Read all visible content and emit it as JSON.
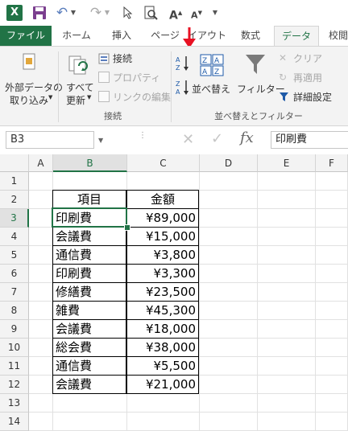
{
  "quick_access": {
    "excel_icon": "X",
    "save_icon": "save-icon",
    "undo_icon": "↶",
    "redo_icon": "↷",
    "pointer_icon": "pointer-icon",
    "preview_icon": "print-preview-icon",
    "font_up": "A",
    "font_down": "A"
  },
  "tabs": [
    "ファイル",
    "ホーム",
    "挿入",
    "ページ",
    "イアウト",
    "数式",
    "データ",
    "校閲"
  ],
  "ribbon": {
    "get_external": [
      "外部データの",
      "取り込み"
    ],
    "refresh_all": [
      "すべて",
      "更新"
    ],
    "connections": "接続",
    "properties": "プロパティ",
    "edit_links": "リンクの編集",
    "group_connections": "接続",
    "sort_az": "A↓Z",
    "sort_label": "並べ替え",
    "filter_label": "フィルター",
    "clear_label": "クリア",
    "reapply_label": "再適用",
    "advanced_label": "詳細設定",
    "group_sort_filter": "並べ替えとフィルター"
  },
  "formula_bar": {
    "name_box": "B3",
    "formula": "印刷費",
    "fx": "fx"
  },
  "columns": [
    "A",
    "B",
    "C",
    "D",
    "E",
    "F"
  ],
  "rows": [
    "1",
    "2",
    "3",
    "4",
    "5",
    "6",
    "7",
    "8",
    "9",
    "10",
    "11",
    "12",
    "13",
    "14"
  ],
  "table": {
    "header_item": "項目",
    "header_amount": "金額",
    "rows": [
      {
        "item": "印刷費",
        "amount": "¥89,000"
      },
      {
        "item": "会議費",
        "amount": "¥15,000"
      },
      {
        "item": "通信費",
        "amount": "¥3,800"
      },
      {
        "item": "印刷費",
        "amount": "¥3,300"
      },
      {
        "item": "修繕費",
        "amount": "¥23,500"
      },
      {
        "item": "雑費",
        "amount": "¥45,300"
      },
      {
        "item": "会議費",
        "amount": "¥18,000"
      },
      {
        "item": "総会費",
        "amount": "¥38,000"
      },
      {
        "item": "通信費",
        "amount": "¥5,500"
      },
      {
        "item": "会議費",
        "amount": "¥21,000"
      }
    ]
  },
  "colors": {
    "excel_green": "#217346",
    "arrow_red": "#e81123",
    "ribbon_bg": "#f3f3f3"
  }
}
